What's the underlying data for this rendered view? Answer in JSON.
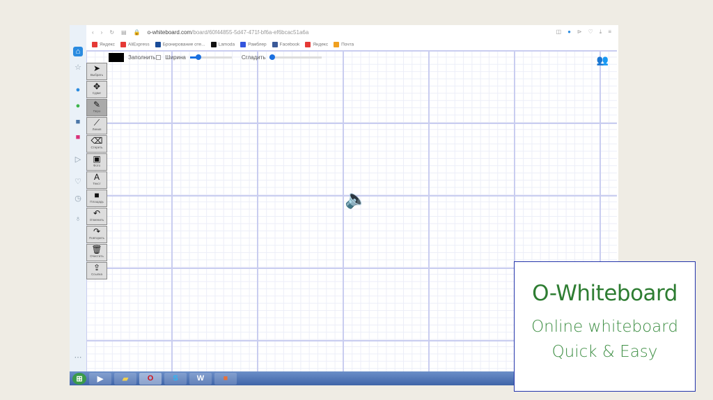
{
  "browser": {
    "url_domain": "o-whiteboard.com",
    "url_path": "/board/60f44855-5d47-471f-bf6a-ef6bcac51a6a",
    "bookmarks": [
      {
        "label": "Яндекс",
        "color": "#e53935"
      },
      {
        "label": "AliExpress",
        "color": "#e53935"
      },
      {
        "label": "Бронирование оте...",
        "color": "#1a4c99"
      },
      {
        "label": "Lamoda",
        "color": "#111111"
      },
      {
        "label": "Рамблер",
        "color": "#3355dd"
      },
      {
        "label": "Facebook",
        "color": "#3b5998"
      },
      {
        "label": "Яндекс",
        "color": "#e53935"
      },
      {
        "label": "Почта",
        "color": "#f0a020"
      }
    ]
  },
  "options": {
    "fill_label": "Заполнить",
    "width_label": "Ширина",
    "smooth_label": "Сгладить",
    "width_value": 0.2,
    "smooth_value": 0.05,
    "color": "#000000"
  },
  "tools": [
    {
      "icon": "cursor-icon",
      "glyph": "➤",
      "label": "Выбрать"
    },
    {
      "icon": "move-icon",
      "glyph": "✥",
      "label": "Сдвиг"
    },
    {
      "icon": "pen-icon",
      "glyph": "✎",
      "label": "Перо",
      "active": true
    },
    {
      "icon": "line-icon",
      "glyph": "⟋",
      "label": "Линия"
    },
    {
      "icon": "eraser-icon",
      "glyph": "⌫",
      "label": "Стереть"
    },
    {
      "icon": "image-icon",
      "glyph": "▣",
      "label": "Фото"
    },
    {
      "icon": "text-icon",
      "glyph": "A",
      "label": "Текст"
    },
    {
      "icon": "rectangle-icon",
      "glyph": "■",
      "label": "Площадь"
    },
    {
      "icon": "undo-icon",
      "glyph": "↶",
      "label": "Отменить"
    },
    {
      "icon": "redo-icon",
      "glyph": "↷",
      "label": "Повторить"
    },
    {
      "icon": "trash-icon",
      "glyph": "🗑",
      "label": "Очистить"
    },
    {
      "icon": "share-icon",
      "glyph": "⇪",
      "label": "Ссылка"
    }
  ],
  "card": {
    "title": "O-Whiteboard",
    "line1": "Online whiteboard",
    "line2": "Quick & Easy"
  }
}
